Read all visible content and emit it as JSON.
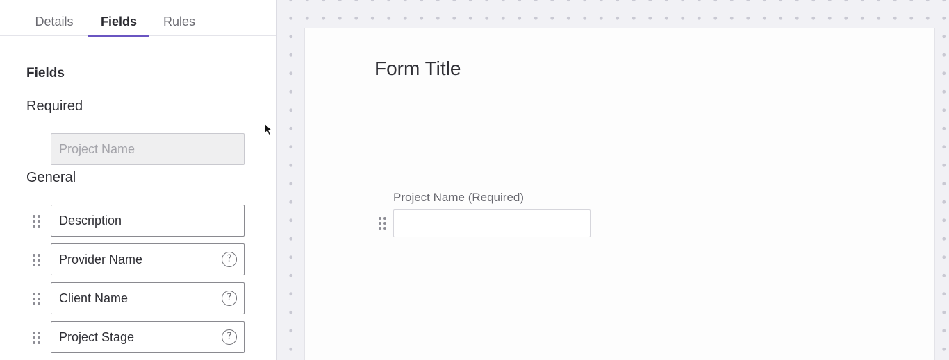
{
  "tabs": {
    "details": "Details",
    "fields": "Fields",
    "rules": "Rules",
    "active": "Fields"
  },
  "panel": {
    "heading": "Fields",
    "required_label": "Required",
    "general_label": "General",
    "required_fields": [
      {
        "label": "Project Name",
        "disabled": true
      }
    ],
    "general_fields": [
      {
        "label": "Description",
        "help": false
      },
      {
        "label": "Provider Name",
        "help": true
      },
      {
        "label": "Client Name",
        "help": true
      },
      {
        "label": "Project Stage",
        "help": true
      }
    ],
    "help_glyph": "?",
    "drag_icon": "drag-handle-icon",
    "help_icon": "question-circle-icon"
  },
  "canvas": {
    "form_title": "Form Title",
    "fields": [
      {
        "label": "Project Name (Required)",
        "value": ""
      }
    ]
  },
  "colors": {
    "accent": "#6a55c2",
    "canvas_bg": "#f1f1f5",
    "dot": "#c9c9d3"
  }
}
